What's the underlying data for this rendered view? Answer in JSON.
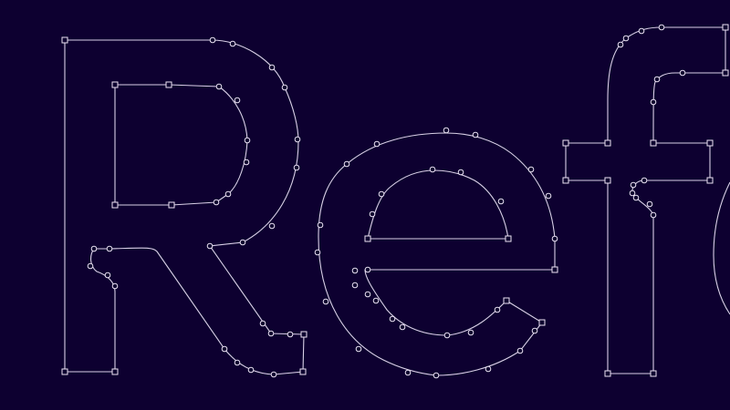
{
  "canvas": {
    "background_color": "#0d0030",
    "outline_color": "#d8d0e6",
    "glyph_text": "Ref"
  },
  "glyphs": [
    {
      "char": "R",
      "name": "glyph-R"
    },
    {
      "char": "e",
      "name": "glyph-e"
    },
    {
      "char": "f",
      "name": "glyph-f"
    },
    {
      "char": "o",
      "name": "glyph-o-partial"
    }
  ]
}
